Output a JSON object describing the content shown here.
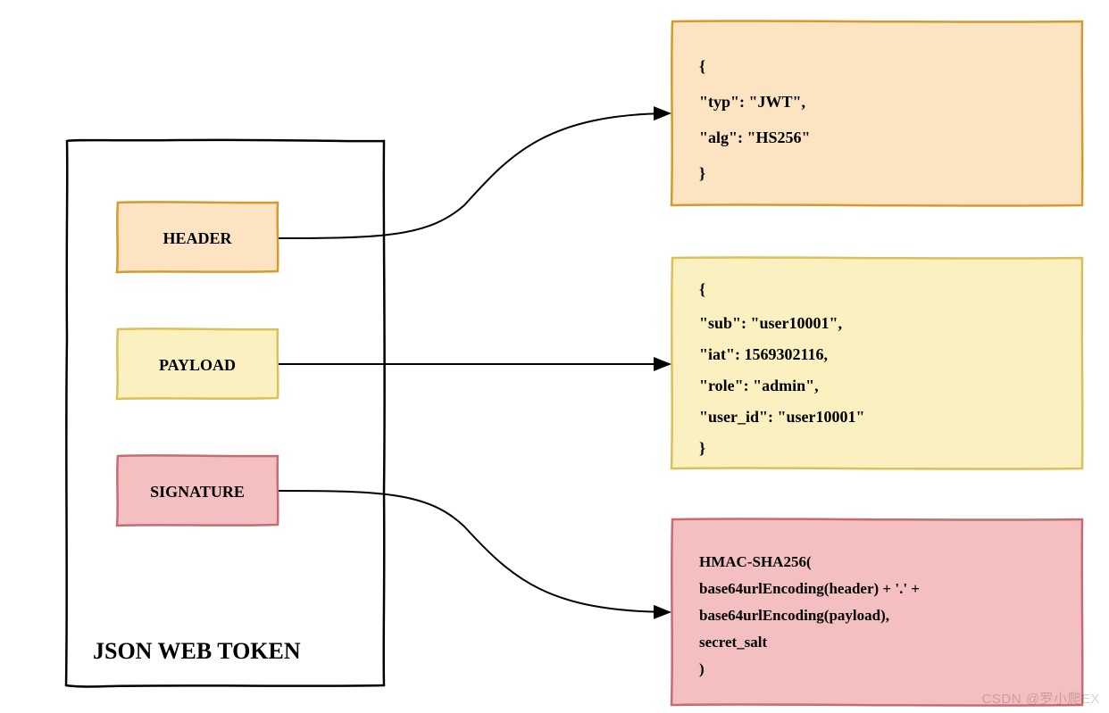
{
  "diagram": {
    "container_title": "JSON WEB TOKEN",
    "parts": {
      "header": {
        "label": "HEADER"
      },
      "payload": {
        "label": "PAYLOAD"
      },
      "signature": {
        "label": "SIGNATURE"
      }
    },
    "details": {
      "header_lines": [
        "{",
        "  \"typ\": \"JWT\",",
        "  \"alg\": \"HS256\"",
        "}"
      ],
      "payload_lines": [
        "{",
        " \"sub\": \"user10001\",",
        " \"iat\": 1569302116,",
        " \"role\": \"admin\",",
        " \"user_id\": \"user10001\"",
        "}"
      ],
      "signature_lines": [
        "HMAC-SHA256(",
        " base64urlEncoding(header) + '.' +",
        " base64urlEncoding(payload),",
        " secret_salt",
        ")"
      ]
    }
  },
  "colors": {
    "header_fill": "#fce3c1",
    "header_stroke": "#d49a2b",
    "payload_fill": "#fbf1c0",
    "payload_stroke": "#d9c05a",
    "signature_fill": "#f4bfc0",
    "signature_stroke": "#c76b72",
    "ink": "#000000"
  },
  "watermark": "CSDN @罗小爬EX"
}
